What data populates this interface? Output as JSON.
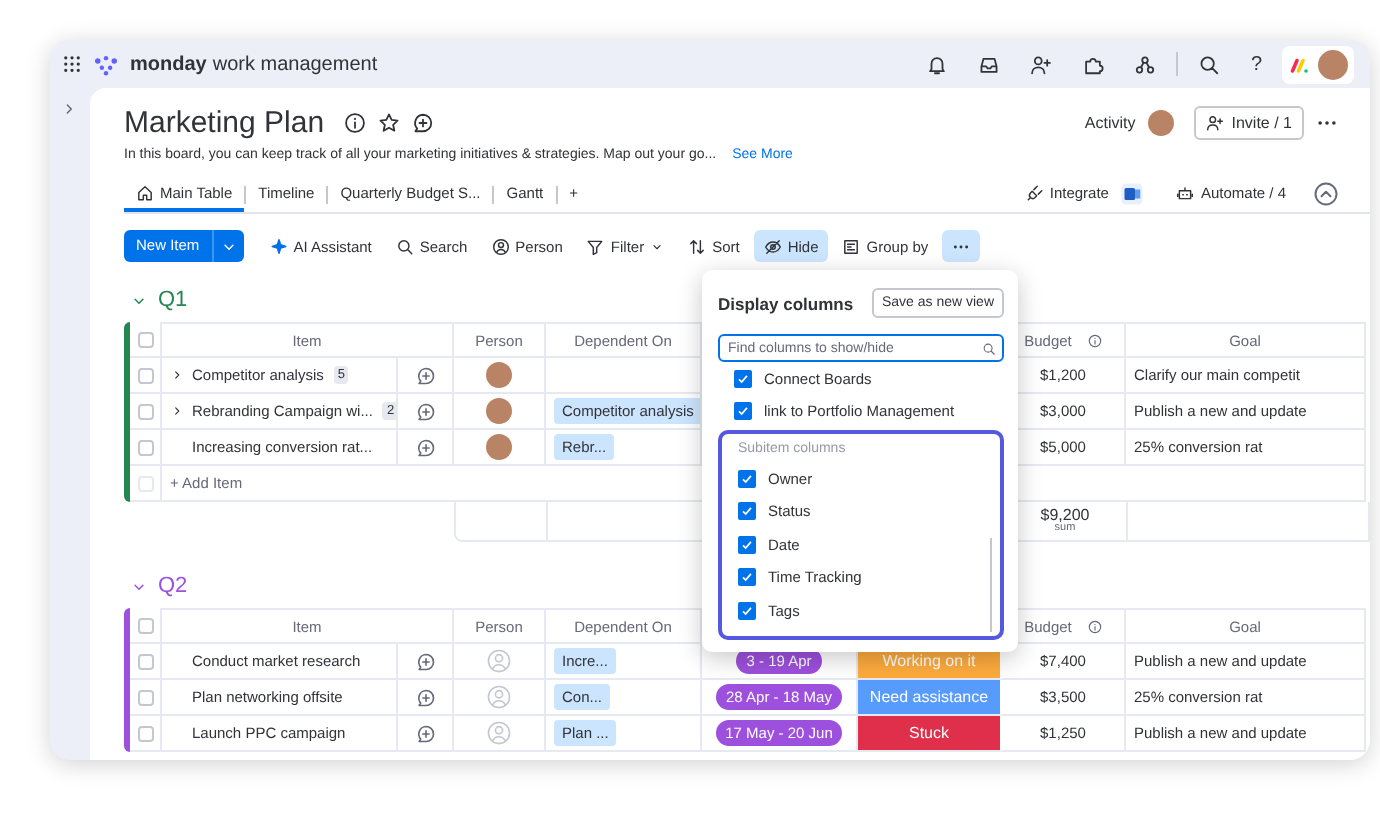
{
  "topbar": {
    "brand": "monday",
    "product": "work management",
    "help": "?"
  },
  "board": {
    "title": "Marketing Plan",
    "description": "In this board, you can keep track of all your marketing initiatives & strategies. Map out your go...",
    "see_more": "See More",
    "activity": "Activity",
    "invite": "Invite / 1"
  },
  "tabs": [
    {
      "label": "Main Table",
      "selected": true,
      "kind": "home"
    },
    {
      "label": "Timeline",
      "selected": false,
      "kind": "plain"
    },
    {
      "label": "Quarterly Budget S...",
      "selected": false,
      "kind": "plain"
    },
    {
      "label": "Gantt",
      "selected": false,
      "kind": "plain"
    }
  ],
  "add_tab": "+",
  "view_actions": {
    "integrate": "Integrate",
    "automate": "Automate / 4"
  },
  "toolbar": {
    "new_item": "New Item",
    "buttons": [
      {
        "kind": "ai",
        "label": "AI Assistant",
        "active": false
      },
      {
        "kind": "search",
        "label": "Search",
        "active": false
      },
      {
        "kind": "person",
        "label": "Person",
        "active": false
      },
      {
        "kind": "filter",
        "label": "Filter",
        "active": false
      },
      {
        "kind": "sort",
        "label": "Sort",
        "active": false
      },
      {
        "kind": "hide",
        "label": "Hide",
        "active": true
      },
      {
        "kind": "group",
        "label": "Group by",
        "active": false
      },
      {
        "kind": "more",
        "active": true
      }
    ]
  },
  "groups": [
    {
      "name": "Q1",
      "color": "#258750",
      "all_checked": false,
      "columns": {
        "item": "Item",
        "person": "Person",
        "dependent": "Dependent On",
        "budget": "Budget",
        "goal": "Goal"
      },
      "rows": [
        {
          "name": "Competitor analysis",
          "subitems": "5",
          "expandable": true,
          "checked": false,
          "assigned": true,
          "budget": "$1,200",
          "goal": "Clarify our main competit"
        },
        {
          "name": "Rebranding Campaign wi...",
          "subitems": "2",
          "expandable": true,
          "checked": false,
          "assigned": true,
          "dependent": "Competitor analysis",
          "budget": "$3,000",
          "goal": "Publish a new and update"
        },
        {
          "name": "Increasing conversion rat...",
          "expandable": false,
          "checked": false,
          "assigned": true,
          "dependent": "Rebr...",
          "budget": "$5,000",
          "goal": "25% conversion rat"
        }
      ],
      "add_item": "+ Add Item",
      "total": "$9,200",
      "total_label": "sum"
    },
    {
      "name": "Q2",
      "color": "#9d50dd",
      "all_checked": false,
      "columns": {
        "item": "Item",
        "person": "Person",
        "dependent": "Dependent On",
        "budget": "Budget",
        "goal": "Goal"
      },
      "rows": [
        {
          "name": "Conduct market research",
          "expandable": false,
          "checked": false,
          "assigned": false,
          "dependent": "Incre...",
          "date": "3 - 19 Apr",
          "status": {
            "label": "Working on it",
            "color": "#fdab3d"
          },
          "budget": "$7,400",
          "goal": "Publish a new and update"
        },
        {
          "name": "Plan networking offsite",
          "expandable": false,
          "checked": false,
          "assigned": false,
          "dependent": "Con...",
          "date": "28 Apr - 18 May",
          "status": {
            "label": "Need assistance",
            "color": "#579bfc"
          },
          "budget": "$3,500",
          "goal": "25% conversion rat"
        },
        {
          "name": "Launch PPC campaign",
          "expandable": false,
          "checked": false,
          "assigned": false,
          "dependent": "Plan ...",
          "date": "17 May - 20 Jun",
          "status": {
            "label": "Stuck",
            "color": "#df2f4a"
          },
          "budget": "$1,250",
          "goal": "Publish a new and update"
        }
      ]
    }
  ],
  "popup": {
    "title": "Display columns",
    "save_view": "Save as new view",
    "search_placeholder": "Find columns to show/hide",
    "items": [
      {
        "label": "Connect Boards",
        "checked": true
      },
      {
        "label": "link to Portfolio Management",
        "checked": true
      }
    ],
    "subitem_section": {
      "title": "Subitem columns",
      "highlighted": true,
      "items": [
        {
          "label": "Owner",
          "checked": true
        },
        {
          "label": "Status",
          "checked": true
        },
        {
          "label": "Date",
          "checked": true
        },
        {
          "label": "Time Tracking",
          "checked": true
        },
        {
          "label": "Tags",
          "checked": true
        }
      ]
    }
  }
}
